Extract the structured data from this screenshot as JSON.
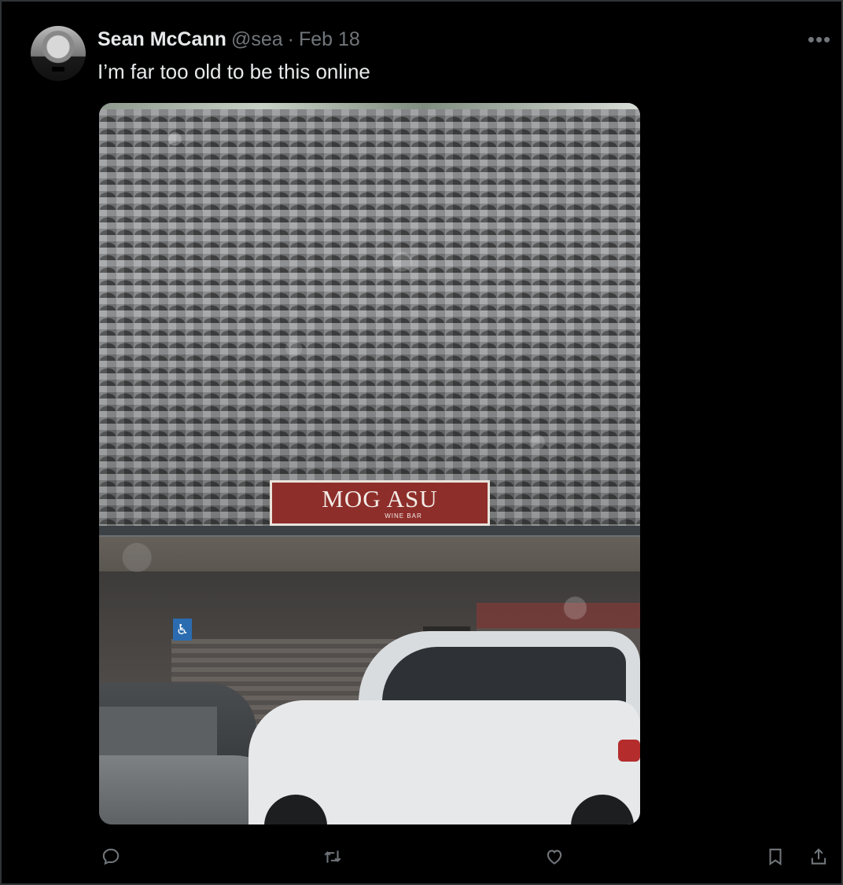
{
  "tweet": {
    "author": {
      "name": "Sean McCann",
      "handle": "@sea",
      "separator": "·",
      "date": "Feb 18"
    },
    "text": "I’m far too old to be this online",
    "more_label": "•••",
    "media": {
      "sign_title": "MOG ASU",
      "sign_subtitle": "WINE BAR",
      "accessibility_symbol": "♿"
    },
    "actions": [
      {
        "name": "reply-icon"
      },
      {
        "name": "retweet-icon"
      },
      {
        "name": "like-icon"
      },
      {
        "name": "bookmark-icon"
      },
      {
        "name": "share-icon"
      }
    ]
  }
}
